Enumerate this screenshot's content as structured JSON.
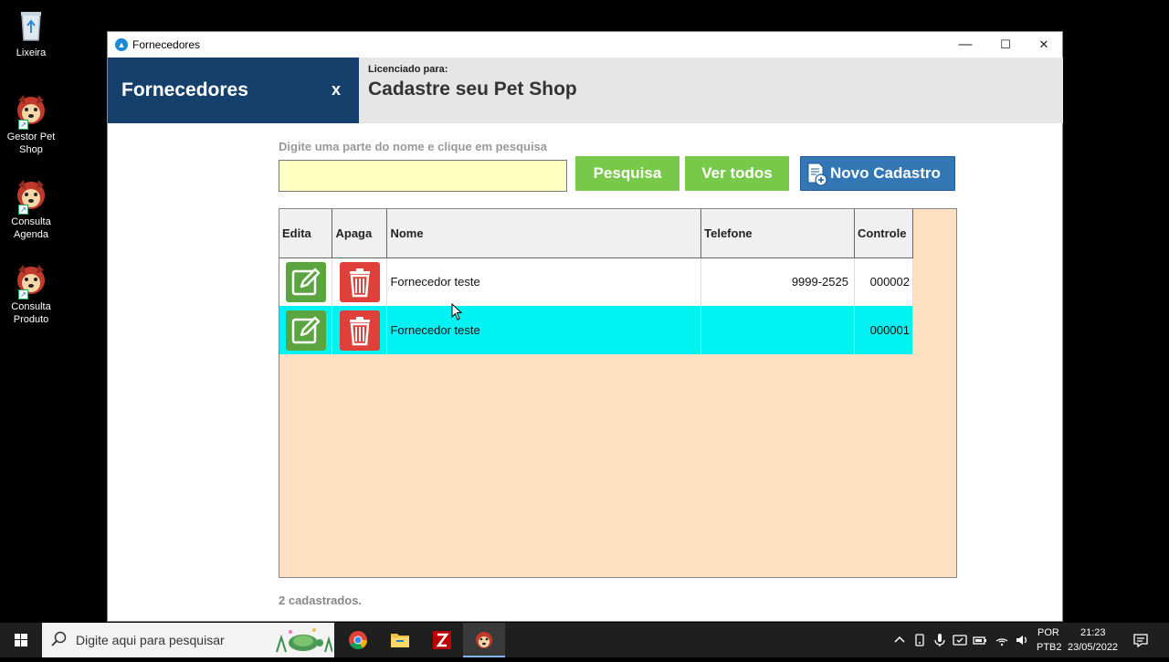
{
  "desktop": {
    "icons": [
      {
        "label": "Lixeira"
      },
      {
        "label": "Gestor Pet Shop"
      },
      {
        "label": "Consulta Agenda"
      },
      {
        "label": "Consulta Produto"
      }
    ]
  },
  "window": {
    "title": "Fornecedores",
    "controls": {
      "minimize": "—",
      "maximize": "☐",
      "close": "✕"
    }
  },
  "header": {
    "title": "Fornecedores",
    "close_label": "x",
    "license_label": "Licenciado para:",
    "license_name": "Cadastre seu Pet Shop"
  },
  "search": {
    "hint": "Digite uma parte do nome e clique em pesquisa",
    "value": "",
    "placeholder": ""
  },
  "buttons": {
    "pesquisa": "Pesquisa",
    "ver_todos": "Ver todos",
    "novo_cadastro": "Novo Cadastro"
  },
  "table": {
    "columns": [
      "Edita",
      "Apaga",
      "Nome",
      "Telefone",
      "Controle"
    ],
    "rows": [
      {
        "nome": "Fornecedor  teste",
        "telefone": "9999-2525",
        "controle": "000002",
        "selected": false
      },
      {
        "nome": "Fornecedor teste",
        "telefone": "",
        "controle": "000001",
        "selected": true
      }
    ]
  },
  "footer": {
    "count_text": "2 cadastrados."
  },
  "taskbar": {
    "search_placeholder": "Digite aqui para pesquisar",
    "lang_line1": "POR",
    "lang_line2": "PTB2",
    "time": "21:23",
    "date": "23/05/2022"
  },
  "colors": {
    "header_dark": "#14406b",
    "green": "#78c84a",
    "blue": "#3377b5",
    "selection": "#00f2f2",
    "grid_bg": "#fde0c2",
    "input_bg": "#ffffc0"
  }
}
